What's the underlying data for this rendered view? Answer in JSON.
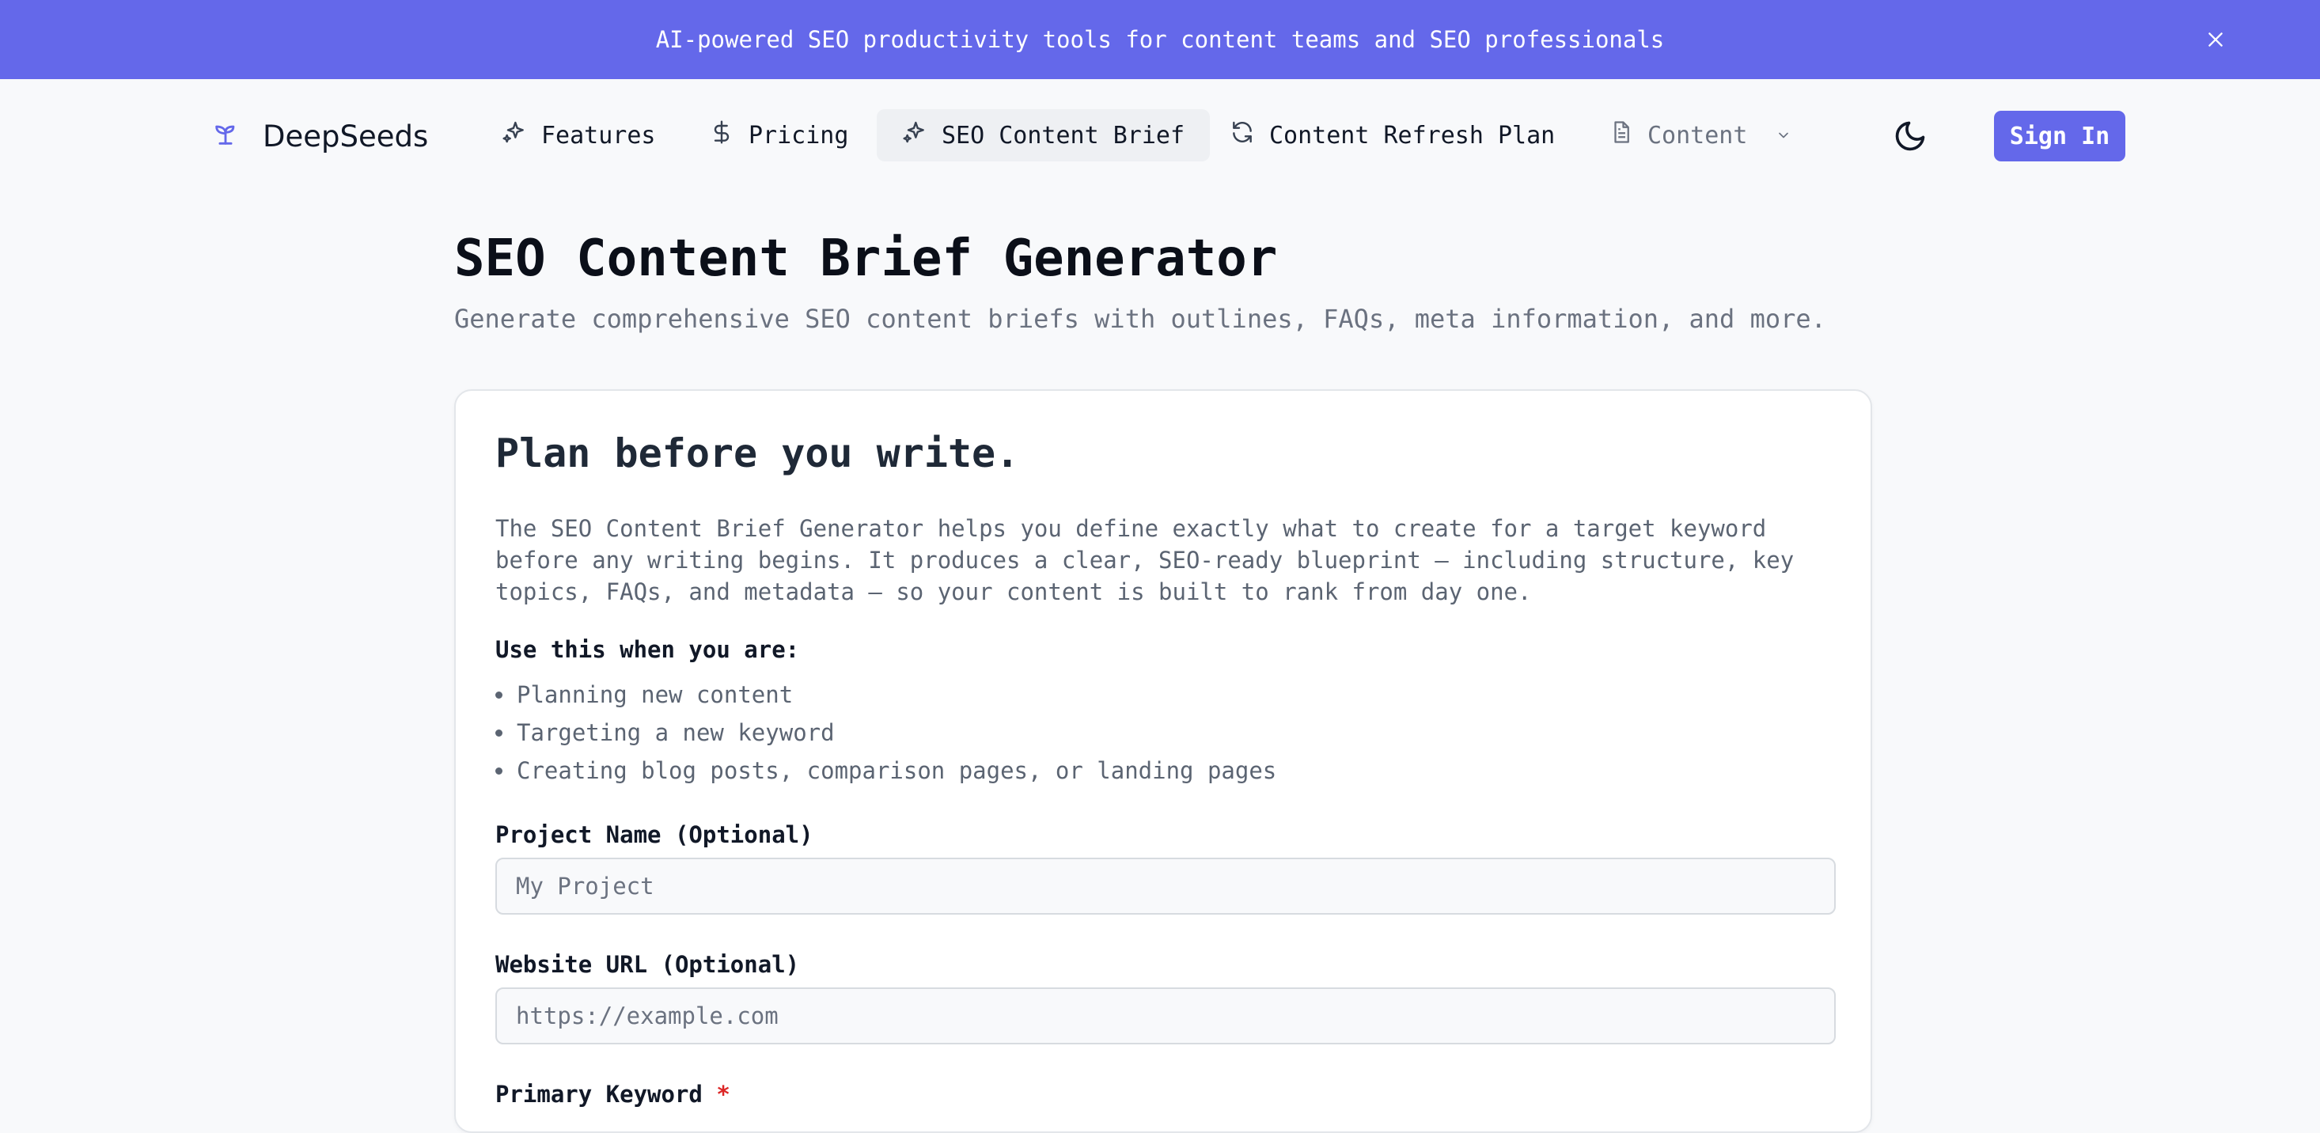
{
  "banner": {
    "text": "AI-powered SEO productivity tools for content teams and SEO professionals",
    "close_icon": "close-icon",
    "background": "#6468ea"
  },
  "header": {
    "logo_text": "DeepSeeds",
    "logo_icon": "sprout-icon",
    "nav": [
      {
        "label": "Features",
        "icon": "sparkles-icon",
        "active": false
      },
      {
        "label": "Pricing",
        "icon": "dollar-icon",
        "active": false
      },
      {
        "label": "SEO Content Brief",
        "icon": "sparkles-icon",
        "active": true
      },
      {
        "label": "Content Refresh Plan",
        "icon": "refresh-icon",
        "active": false
      },
      {
        "label": "Content",
        "icon": "document-icon",
        "active": false,
        "dropdown": true
      }
    ],
    "theme_icon": "moon-icon",
    "sign_in_label": "Sign In"
  },
  "page": {
    "title": "SEO Content Brief Generator",
    "subtitle": "Generate comprehensive SEO content briefs with outlines, FAQs, meta information, and more."
  },
  "card": {
    "heading": "Plan before you write.",
    "description": "The SEO Content Brief Generator helps you define exactly what to create for a target keyword before any writing begins. It produces a clear, SEO-ready blueprint — including structure, key topics, FAQs, and metadata — so your content is built to rank from day one.",
    "use_label": "Use this when you are:",
    "use_cases": [
      "Planning new content",
      "Targeting a new keyword",
      "Creating blog posts, comparison pages, or landing pages"
    ],
    "fields": [
      {
        "label": "Project Name (Optional)",
        "placeholder": "My Project",
        "value": ""
      },
      {
        "label": "Website URL (Optional)",
        "placeholder": "https://example.com",
        "value": ""
      },
      {
        "label": "Primary Keyword",
        "required_mark": "*"
      }
    ]
  },
  "colors": {
    "accent": "#6468ea",
    "required": "#dc2626"
  }
}
